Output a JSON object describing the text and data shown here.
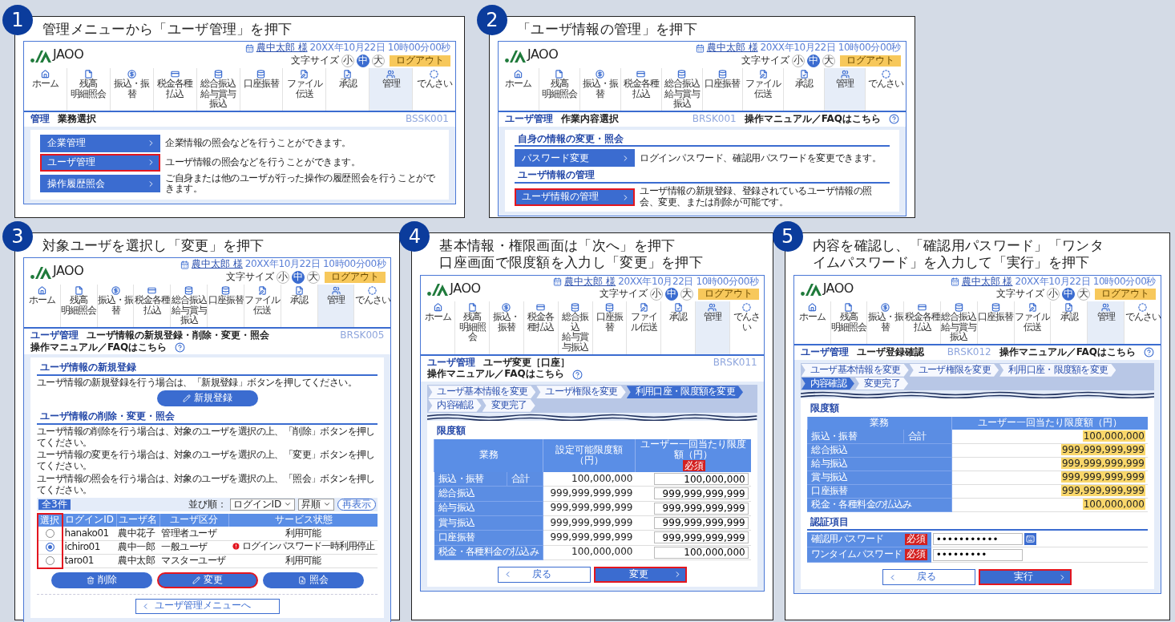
{
  "panels": [
    {
      "number": "1",
      "title_lines": [
        "管理メニューから「ユーザ管理」を押下"
      ],
      "screen": {
        "header": {
          "logo": "JAOO",
          "user": "農中太郎 様",
          "datetime": "20XX年10月22日 10時00分00秒",
          "font_size_label": "文字サイズ",
          "font_sizes": [
            {
              "label": "小",
              "selected": false
            },
            {
              "label": "中",
              "selected": true
            },
            {
              "label": "大",
              "selected": false
            }
          ],
          "logout": "ログアウト",
          "nav": [
            {
              "lines": [
                "ホーム"
              ],
              "selected": false
            },
            {
              "lines": [
                "残高",
                "明細照会"
              ],
              "selected": false
            },
            {
              "lines": [
                "振込・振替"
              ],
              "selected": false
            },
            {
              "lines": [
                "税金各種払込"
              ],
              "selected": false
            },
            {
              "lines": [
                "総合振込",
                "給与賞与振込"
              ],
              "selected": false
            },
            {
              "lines": [
                "口座振替"
              ],
              "selected": false
            },
            {
              "lines": [
                "ファイル伝送"
              ],
              "selected": false
            },
            {
              "lines": [
                "承認"
              ],
              "selected": false
            },
            {
              "lines": [
                "管理"
              ],
              "selected": true
            },
            {
              "lines": [
                "でんさい"
              ],
              "selected": false
            }
          ]
        },
        "page_bar": {
          "section": "管理",
          "title": "業務選択",
          "code": "BSSK001"
        },
        "content": {
          "kind": "menu",
          "items": [
            {
              "label": "企業管理",
              "description": "企業情報の照会などを行うことができます。",
              "highlighted": false
            },
            {
              "label": "ユーザ管理",
              "description": "ユーザ情報の照会などを行うことができます。",
              "highlighted": true
            },
            {
              "label": "操作履歴照会",
              "description": "ご自身または他のユーザが行った操作の履歴照会を行うことができます。",
              "highlighted": false
            }
          ]
        }
      }
    },
    {
      "number": "2",
      "title_lines": [
        "「ユーザ情報の管理」を押下"
      ],
      "screen": {
        "header": {
          "logo": "JAOO",
          "user": "農中太郎 様",
          "datetime": "20XX年10月22日 10時00分00秒",
          "font_size_label": "文字サイズ",
          "font_sizes": [
            {
              "label": "小",
              "selected": false
            },
            {
              "label": "中",
              "selected": true
            },
            {
              "label": "大",
              "selected": false
            }
          ],
          "logout": "ログアウト",
          "nav": [
            {
              "lines": [
                "ホーム"
              ],
              "selected": false
            },
            {
              "lines": [
                "残高",
                "明細照会"
              ],
              "selected": false
            },
            {
              "lines": [
                "振込・振替"
              ],
              "selected": false
            },
            {
              "lines": [
                "税金各種払込"
              ],
              "selected": false
            },
            {
              "lines": [
                "総合振込",
                "給与賞与振込"
              ],
              "selected": false
            },
            {
              "lines": [
                "口座振替"
              ],
              "selected": false
            },
            {
              "lines": [
                "ファイル伝送"
              ],
              "selected": false
            },
            {
              "lines": [
                "承認"
              ],
              "selected": false
            },
            {
              "lines": [
                "管理"
              ],
              "selected": true
            },
            {
              "lines": [
                "でんさい"
              ],
              "selected": false
            }
          ]
        },
        "page_bar": {
          "section": "ユーザ管理",
          "title": "作業内容選択",
          "code": "BRSK001",
          "help": "操作マニュアル／FAQはこちら"
        },
        "content": {
          "kind": "menu_sections",
          "sections": [
            {
              "heading": "自身の情報の変更・照会",
              "items": [
                {
                  "label": "パスワード変更",
                  "description": "ログインパスワード、確認用パスワードを変更できます。",
                  "highlighted": false
                }
              ]
            },
            {
              "heading": "ユーザ情報の管理",
              "items": [
                {
                  "label": "ユーザ情報の管理",
                  "description": "ユーザ情報の新規登録、登録されているユーザ情報の照会、変更、または削除が可能です。",
                  "highlighted": true
                }
              ]
            }
          ]
        }
      }
    },
    {
      "number": "3",
      "title_lines": [
        "対象ユーザを選択し「変更」を押下"
      ],
      "screen": {
        "header": {
          "logo": "JAOO",
          "user": "農中太郎 様",
          "datetime": "20XX年10月22日 10時00分00秒",
          "font_size_label": "文字サイズ",
          "font_sizes": [
            {
              "label": "小",
              "selected": false
            },
            {
              "label": "中",
              "selected": true
            },
            {
              "label": "大",
              "selected": false
            }
          ],
          "logout": "ログアウト",
          "nav": [
            {
              "lines": [
                "ホーム"
              ],
              "selected": false
            },
            {
              "lines": [
                "残高",
                "明細照会"
              ],
              "selected": false
            },
            {
              "lines": [
                "振込・振替"
              ],
              "selected": false
            },
            {
              "lines": [
                "税金各種払込"
              ],
              "selected": false
            },
            {
              "lines": [
                "総合振込",
                "給与賞与振込"
              ],
              "selected": false
            },
            {
              "lines": [
                "口座振替"
              ],
              "selected": false
            },
            {
              "lines": [
                "ファイル伝送"
              ],
              "selected": false
            },
            {
              "lines": [
                "承認"
              ],
              "selected": false
            },
            {
              "lines": [
                "管理"
              ],
              "selected": true
            },
            {
              "lines": [
                "でんさい"
              ],
              "selected": false
            }
          ]
        },
        "page_bar": {
          "section": "ユーザ管理",
          "title": "ユーザ情報の新規登録・削除・変更・照会",
          "code": "BRSK005",
          "help": "操作マニュアル／FAQはこちら"
        },
        "content": {
          "kind": "user_list",
          "new_section": {
            "heading": "ユーザ情報の新規登録",
            "text": "ユーザ情報の新規登録を行う場合は、「新規登録」ボタンを押してください。",
            "button": "新規登録"
          },
          "list_section": {
            "heading": "ユーザ情報の削除・変更・照会",
            "texts": [
              "ユーザ情報の削除を行う場合は、対象のユーザを選択の上、「削除」ボタンを押してください。",
              "ユーザ情報の変更を行う場合は、対象のユーザを選択の上、「変更」ボタンを押してください。",
              "ユーザ情報の照会を行う場合は、対象のユーザを選択の上、「照会」ボタンを押してください。"
            ],
            "count": "全3件",
            "sort_label": "並び順：",
            "sort_field": "ログインID",
            "sort_order": "昇順",
            "refresh": "再表示",
            "columns": [
              {
                "label": "選択",
                "highlighted": true
              },
              {
                "label": "ログインID",
                "highlighted": false
              },
              {
                "label": "ユーザ名",
                "highlighted": false
              },
              {
                "label": "ユーザ区分",
                "highlighted": false
              },
              {
                "label": "サービス状態",
                "highlighted": false
              }
            ],
            "rows": [
              {
                "selected": false,
                "login_id": "hanako01",
                "name": "農中花子",
                "type": "管理者ユーザ",
                "status": "利用可能",
                "alert": false
              },
              {
                "selected": true,
                "login_id": "ichiro01",
                "name": "農中一郎",
                "type": "一般ユーザ",
                "status": "ログインパスワード一時利用停止",
                "alert": true
              },
              {
                "selected": false,
                "login_id": "taro01",
                "name": "農中太郎",
                "type": "マスターユーザ",
                "status": "利用可能",
                "alert": false
              }
            ],
            "actions": [
              {
                "label": "削除",
                "highlighted": false
              },
              {
                "label": "変更",
                "highlighted": true
              },
              {
                "label": "照会",
                "highlighted": false
              }
            ],
            "back": "ユーザ管理メニューへ"
          }
        }
      }
    },
    {
      "number": "4",
      "title_lines": [
        "基本情報・権限画面は「次へ」を押下",
        "口座画面で限度額を入力し「変更」を押下"
      ],
      "screen": {
        "header": {
          "logo": "JAOO",
          "user": "農中太郎 様",
          "datetime": "20XX年10月22日 10時00分00秒",
          "font_size_label": "文字サイズ",
          "font_sizes": [
            {
              "label": "小",
              "selected": false
            },
            {
              "label": "中",
              "selected": true
            },
            {
              "label": "大",
              "selected": false
            }
          ],
          "logout": "ログアウト",
          "nav": [
            {
              "lines": [
                "ホーム"
              ],
              "selected": false
            },
            {
              "lines": [
                "残高",
                "明細照会"
              ],
              "selected": false
            },
            {
              "lines": [
                "振込・振替"
              ],
              "selected": false
            },
            {
              "lines": [
                "税金各種払込"
              ],
              "selected": false
            },
            {
              "lines": [
                "総合振込",
                "給与賞与振込"
              ],
              "selected": false
            },
            {
              "lines": [
                "口座振替"
              ],
              "selected": false
            },
            {
              "lines": [
                "ファイル伝送"
              ],
              "selected": false
            },
            {
              "lines": [
                "承認"
              ],
              "selected": false
            },
            {
              "lines": [
                "管理"
              ],
              "selected": true
            },
            {
              "lines": [
                "でんさい"
              ],
              "selected": false
            }
          ]
        },
        "page_bar": {
          "section": "ユーザ管理",
          "title": "ユーザ変更［口座］",
          "code": "BRSK011",
          "help": "操作マニュアル／FAQはこちら"
        },
        "content": {
          "kind": "limit_edit",
          "steps": [
            {
              "label": "ユーザ基本情報を変更",
              "selected": false
            },
            {
              "label": "ユーザ権限を変更",
              "selected": false
            },
            {
              "label": "利用口座・限度額を変更",
              "selected": true
            },
            {
              "label": "内容確認",
              "selected": false
            },
            {
              "label": "変更完了",
              "selected": false
            }
          ],
          "heading": "限度額",
          "columns": [
            {
              "label": "業務"
            },
            {
              "label": "設定可能限度額（円）"
            },
            {
              "label": "ユーザー一回当たり限度額（円）",
              "badge": "必須"
            }
          ],
          "rows": [
            {
              "labels": [
                "振込・振替",
                "合計"
              ],
              "limit": "100,000,000",
              "value": "100,000,000"
            },
            {
              "labels": [
                "総合振込"
              ],
              "limit": "999,999,999,999",
              "value": "999,999,999,999"
            },
            {
              "labels": [
                "給与振込"
              ],
              "limit": "999,999,999,999",
              "value": "999,999,999,999"
            },
            {
              "labels": [
                "賞与振込"
              ],
              "limit": "999,999,999,999",
              "value": "999,999,999,999"
            },
            {
              "labels": [
                "口座振替"
              ],
              "limit": "999,999,999,999",
              "value": "999,999,999,999"
            },
            {
              "labels": [
                "税金・各種料金の払込み"
              ],
              "limit": "100,000,000",
              "value": "100,000,000"
            }
          ],
          "back": "戻る",
          "submit": {
            "label": "変更",
            "highlighted": true
          }
        }
      }
    },
    {
      "number": "5",
      "title_lines": [
        "内容を確認し、「確認用パスワード」「ワンタ",
        "イムパスワード」を入力して「実行」を押下"
      ],
      "screen": {
        "header": {
          "logo": "JAOO",
          "user": "農中太郎 様",
          "datetime": "20XX年10月22日 10時00分00秒",
          "font_size_label": "文字サイズ",
          "font_sizes": [
            {
              "label": "小",
              "selected": false
            },
            {
              "label": "中",
              "selected": true
            },
            {
              "label": "大",
              "selected": false
            }
          ],
          "logout": "ログアウト",
          "nav": [
            {
              "lines": [
                "ホーム"
              ],
              "selected": false
            },
            {
              "lines": [
                "残高",
                "明細照会"
              ],
              "selected": false
            },
            {
              "lines": [
                "振込・振替"
              ],
              "selected": false
            },
            {
              "lines": [
                "税金各種払込"
              ],
              "selected": false
            },
            {
              "lines": [
                "総合振込",
                "給与賞与振込"
              ],
              "selected": false
            },
            {
              "lines": [
                "口座振替"
              ],
              "selected": false
            },
            {
              "lines": [
                "ファイル伝送"
              ],
              "selected": false
            },
            {
              "lines": [
                "承認"
              ],
              "selected": false
            },
            {
              "lines": [
                "管理"
              ],
              "selected": true
            },
            {
              "lines": [
                "でんさい"
              ],
              "selected": false
            }
          ]
        },
        "page_bar": {
          "section": "ユーザ管理",
          "title": "ユーザ登録確認",
          "code": "BRSK012",
          "help": "操作マニュアル／FAQはこちら"
        },
        "content": {
          "kind": "limit_confirm",
          "steps": [
            {
              "label": "ユーザ基本情報を変更",
              "selected": false
            },
            {
              "label": "ユーザ権限を変更",
              "selected": false
            },
            {
              "label": "利用口座・限度額を変更",
              "selected": false
            },
            {
              "label": "内容確認",
              "selected": true
            },
            {
              "label": "変更完了",
              "selected": false
            }
          ],
          "heading": "限度額",
          "columns": [
            {
              "label": "業務"
            },
            {
              "label": "ユーザー一回当たり限度額（円）"
            }
          ],
          "rows": [
            {
              "labels": [
                "振込・振替",
                "合計"
              ],
              "value": "100,000,000",
              "highlighted": true
            },
            {
              "labels": [
                "総合振込"
              ],
              "value": "999,999,999,999",
              "highlighted": true
            },
            {
              "labels": [
                "給与振込"
              ],
              "value": "999,999,999,999",
              "highlighted": true
            },
            {
              "labels": [
                "賞与振込"
              ],
              "value": "999,999,999,999",
              "highlighted": true
            },
            {
              "labels": [
                "口座振替"
              ],
              "value": "999,999,999,999",
              "highlighted": true
            },
            {
              "labels": [
                "税金・各種料金の払込み"
              ],
              "value": "100,000,000",
              "highlighted": true
            }
          ],
          "auth_heading": "認証項目",
          "auth": [
            {
              "label": "確認用パスワード",
              "badge": "必須",
              "value": "•••••••••••",
              "keyboard": true
            },
            {
              "label": "ワンタイムパスワード",
              "badge": "必須",
              "value": "•••••••••",
              "keyboard": false
            }
          ],
          "back": "戻る",
          "submit": {
            "label": "実行",
            "highlighted": true
          }
        }
      }
    }
  ]
}
